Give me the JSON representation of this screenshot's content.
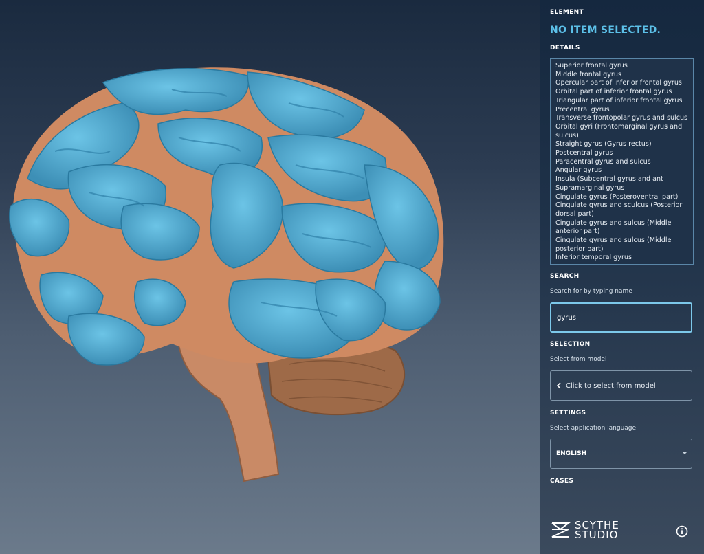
{
  "panel": {
    "element_title": "ELEMENT",
    "element_value": "NO ITEM SELECTED.",
    "details_title": "DETAILS",
    "details_items": [
      "Superior frontal gyrus",
      "Middle frontal gyrus",
      "Opercular part of  inferior frontal gyrus",
      "Orbital part of  inferior frontal gyrus",
      "Triangular part of  inferior frontal gyrus",
      "Precentral gyrus",
      "Transverse frontopolar gyrus and sulcus",
      "Orbital gyri (Frontomarginal gyrus and sulcus)",
      "Straight gyrus (Gyrus rectus)",
      "Postcentral gyrus",
      "Paracentral gyrus and sulcus",
      "Angular gyrus",
      "Insula (Subcentral gyrus and ant",
      "Supramarginal gyrus",
      "Cingulate gyrus (Posteroventral part)",
      "Cingulate gyrus and sculcus (Posterior dorsal part)",
      "Cingulate gyrus and sulcus (Middle anterior part)",
      "Cingulate gyrus and sulcus (Middle posterior part)",
      "Inferior temporal gyrus"
    ],
    "search_title": "SEARCH",
    "search_sub": "Search for by typing name",
    "search_value": "gyrus",
    "selection_title": "SELECTION",
    "selection_sub": "Select from model",
    "selection_button": "Click to select from model",
    "settings_title": "SETTINGS",
    "settings_sub": "Select application language",
    "language_value": "ENGLISH",
    "cases_title": "CASES",
    "logo_line1": "SCYTHE",
    "logo_line2": "STUDIO",
    "info_icon": "info-icon"
  },
  "viewport": {
    "model_name": "brain-3d-model",
    "colors": {
      "gyrus_blue": "#5bb4d8",
      "other_orange": "#cf8a62",
      "cerebellum_brown": "#a06a48",
      "accent": "#5cc0e8"
    }
  }
}
